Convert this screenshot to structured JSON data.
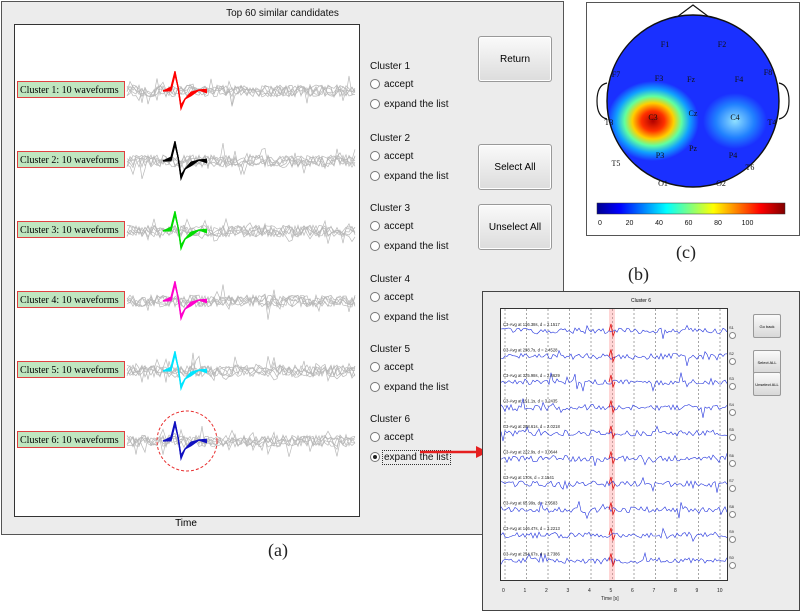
{
  "panel_a": {
    "title": "Top 60 similar candidates",
    "xlabel": "Time",
    "caption": "(a)",
    "clusters": [
      {
        "label": "Cluster  1:  10  waveforms",
        "name": "Cluster 1",
        "accept": "accept",
        "expand": "expand the list",
        "color": "#ff0000"
      },
      {
        "label": "Cluster  2:  10  waveforms",
        "name": "Cluster 2",
        "accept": "accept",
        "expand": "expand the list",
        "color": "#000000"
      },
      {
        "label": "Cluster  3:  10  waveforms",
        "name": "Cluster 3",
        "accept": "accept",
        "expand": "expand the list",
        "color": "#00dd00"
      },
      {
        "label": "Cluster  4:  10  waveforms",
        "name": "Cluster 4",
        "accept": "accept",
        "expand": "expand the list",
        "color": "#ff00cc"
      },
      {
        "label": "Cluster  5:  10  waveforms",
        "name": "Cluster 5",
        "accept": "accept",
        "expand": "expand the list",
        "color": "#00e5ff"
      },
      {
        "label": "Cluster  6:  10  waveforms",
        "name": "Cluster 6",
        "accept": "accept",
        "expand": "expand the list",
        "color": "#1010c0",
        "selected": "expand"
      }
    ],
    "buttons": {
      "return": "Return",
      "select_all": "Select All",
      "unselect_all": "Unselect All"
    }
  },
  "panel_b": {
    "title": "Cluster 6",
    "caption": "(b)",
    "xlabel": "Time [s]",
    "x_ticks": [
      "0",
      "1",
      "2",
      "3",
      "4",
      "5",
      "6",
      "7",
      "8",
      "9",
      "10"
    ],
    "rows": [
      {
        "text": "C3-Avg   at 136.38s,  d = 2.1517",
        "side": "S1"
      },
      {
        "text": "C3-Avg   at 298.7s,  d = 2.4528",
        "side": "S2"
      },
      {
        "text": "C3-Avg   at 325.98s,  d = 2.4629",
        "side": "S3"
      },
      {
        "text": "C3-Avg   at 151.1s,  d = 3.2435",
        "side": "S4"
      },
      {
        "text": "C3-Avg   at 208.61s,  d = 2.0218",
        "side": "S5"
      },
      {
        "text": "C3-Avg   at 222.9s,  d = 3.0644",
        "side": "S6"
      },
      {
        "text": "C3-Avg   at 170s,  d = 2.1541",
        "side": "S7"
      },
      {
        "text": "C3-Avg   at 65.99s,  d = 2.9583",
        "side": "S8"
      },
      {
        "text": "C3-Avg   at 146.47s,  d = 3.2213",
        "side": "S9"
      },
      {
        "text": "C3-Avg   at 254.67s,  d = 2.7386",
        "side": "S0"
      }
    ],
    "buttons": {
      "go_back": "Go back",
      "select_all": "Select ALL",
      "unselect_all": "Unselect ALL"
    }
  },
  "panel_c": {
    "caption": "(c)",
    "electrodes": [
      "F1",
      "F2",
      "F7",
      "F3",
      "Fz",
      "F4",
      "F8",
      "T3",
      "C3",
      "Cz",
      "C4",
      "T4",
      "T5",
      "P3",
      "Pz",
      "P4",
      "T6",
      "O1",
      "O2"
    ],
    "colorbar_ticks": [
      "0",
      "20",
      "40",
      "60",
      "80",
      "100"
    ]
  }
}
